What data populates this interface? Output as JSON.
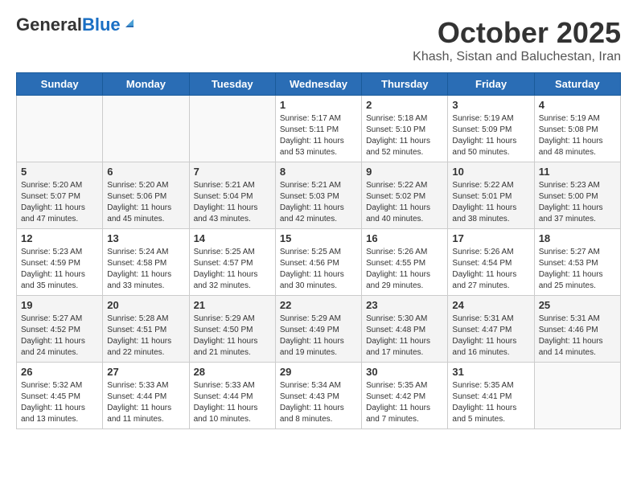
{
  "header": {
    "logo_general": "General",
    "logo_blue": "Blue",
    "month": "October 2025",
    "location": "Khash, Sistan and Baluchestan, Iran"
  },
  "days_of_week": [
    "Sunday",
    "Monday",
    "Tuesday",
    "Wednesday",
    "Thursday",
    "Friday",
    "Saturday"
  ],
  "weeks": [
    [
      {
        "day": "",
        "info": ""
      },
      {
        "day": "",
        "info": ""
      },
      {
        "day": "",
        "info": ""
      },
      {
        "day": "1",
        "info": "Sunrise: 5:17 AM\nSunset: 5:11 PM\nDaylight: 11 hours\nand 53 minutes."
      },
      {
        "day": "2",
        "info": "Sunrise: 5:18 AM\nSunset: 5:10 PM\nDaylight: 11 hours\nand 52 minutes."
      },
      {
        "day": "3",
        "info": "Sunrise: 5:19 AM\nSunset: 5:09 PM\nDaylight: 11 hours\nand 50 minutes."
      },
      {
        "day": "4",
        "info": "Sunrise: 5:19 AM\nSunset: 5:08 PM\nDaylight: 11 hours\nand 48 minutes."
      }
    ],
    [
      {
        "day": "5",
        "info": "Sunrise: 5:20 AM\nSunset: 5:07 PM\nDaylight: 11 hours\nand 47 minutes."
      },
      {
        "day": "6",
        "info": "Sunrise: 5:20 AM\nSunset: 5:06 PM\nDaylight: 11 hours\nand 45 minutes."
      },
      {
        "day": "7",
        "info": "Sunrise: 5:21 AM\nSunset: 5:04 PM\nDaylight: 11 hours\nand 43 minutes."
      },
      {
        "day": "8",
        "info": "Sunrise: 5:21 AM\nSunset: 5:03 PM\nDaylight: 11 hours\nand 42 minutes."
      },
      {
        "day": "9",
        "info": "Sunrise: 5:22 AM\nSunset: 5:02 PM\nDaylight: 11 hours\nand 40 minutes."
      },
      {
        "day": "10",
        "info": "Sunrise: 5:22 AM\nSunset: 5:01 PM\nDaylight: 11 hours\nand 38 minutes."
      },
      {
        "day": "11",
        "info": "Sunrise: 5:23 AM\nSunset: 5:00 PM\nDaylight: 11 hours\nand 37 minutes."
      }
    ],
    [
      {
        "day": "12",
        "info": "Sunrise: 5:23 AM\nSunset: 4:59 PM\nDaylight: 11 hours\nand 35 minutes."
      },
      {
        "day": "13",
        "info": "Sunrise: 5:24 AM\nSunset: 4:58 PM\nDaylight: 11 hours\nand 33 minutes."
      },
      {
        "day": "14",
        "info": "Sunrise: 5:25 AM\nSunset: 4:57 PM\nDaylight: 11 hours\nand 32 minutes."
      },
      {
        "day": "15",
        "info": "Sunrise: 5:25 AM\nSunset: 4:56 PM\nDaylight: 11 hours\nand 30 minutes."
      },
      {
        "day": "16",
        "info": "Sunrise: 5:26 AM\nSunset: 4:55 PM\nDaylight: 11 hours\nand 29 minutes."
      },
      {
        "day": "17",
        "info": "Sunrise: 5:26 AM\nSunset: 4:54 PM\nDaylight: 11 hours\nand 27 minutes."
      },
      {
        "day": "18",
        "info": "Sunrise: 5:27 AM\nSunset: 4:53 PM\nDaylight: 11 hours\nand 25 minutes."
      }
    ],
    [
      {
        "day": "19",
        "info": "Sunrise: 5:27 AM\nSunset: 4:52 PM\nDaylight: 11 hours\nand 24 minutes."
      },
      {
        "day": "20",
        "info": "Sunrise: 5:28 AM\nSunset: 4:51 PM\nDaylight: 11 hours\nand 22 minutes."
      },
      {
        "day": "21",
        "info": "Sunrise: 5:29 AM\nSunset: 4:50 PM\nDaylight: 11 hours\nand 21 minutes."
      },
      {
        "day": "22",
        "info": "Sunrise: 5:29 AM\nSunset: 4:49 PM\nDaylight: 11 hours\nand 19 minutes."
      },
      {
        "day": "23",
        "info": "Sunrise: 5:30 AM\nSunset: 4:48 PM\nDaylight: 11 hours\nand 17 minutes."
      },
      {
        "day": "24",
        "info": "Sunrise: 5:31 AM\nSunset: 4:47 PM\nDaylight: 11 hours\nand 16 minutes."
      },
      {
        "day": "25",
        "info": "Sunrise: 5:31 AM\nSunset: 4:46 PM\nDaylight: 11 hours\nand 14 minutes."
      }
    ],
    [
      {
        "day": "26",
        "info": "Sunrise: 5:32 AM\nSunset: 4:45 PM\nDaylight: 11 hours\nand 13 minutes."
      },
      {
        "day": "27",
        "info": "Sunrise: 5:33 AM\nSunset: 4:44 PM\nDaylight: 11 hours\nand 11 minutes."
      },
      {
        "day": "28",
        "info": "Sunrise: 5:33 AM\nSunset: 4:44 PM\nDaylight: 11 hours\nand 10 minutes."
      },
      {
        "day": "29",
        "info": "Sunrise: 5:34 AM\nSunset: 4:43 PM\nDaylight: 11 hours\nand 8 minutes."
      },
      {
        "day": "30",
        "info": "Sunrise: 5:35 AM\nSunset: 4:42 PM\nDaylight: 11 hours\nand 7 minutes."
      },
      {
        "day": "31",
        "info": "Sunrise: 5:35 AM\nSunset: 4:41 PM\nDaylight: 11 hours\nand 5 minutes."
      },
      {
        "day": "",
        "info": ""
      }
    ]
  ]
}
